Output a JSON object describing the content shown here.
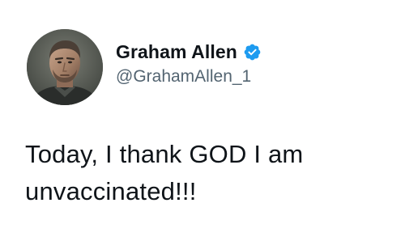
{
  "tweet": {
    "author": {
      "display_name": "Graham Allen",
      "handle": "@GrahamAllen_1",
      "verified": true,
      "verified_icon": "verified-badge-icon",
      "avatar": "profile-photo"
    },
    "text": "Today, I thank GOD I am unvaccinated!!!"
  },
  "colors": {
    "background": "#ffffff",
    "text_primary": "#0f1419",
    "text_secondary": "#536471",
    "verified_blue": "#1d9bf0"
  }
}
